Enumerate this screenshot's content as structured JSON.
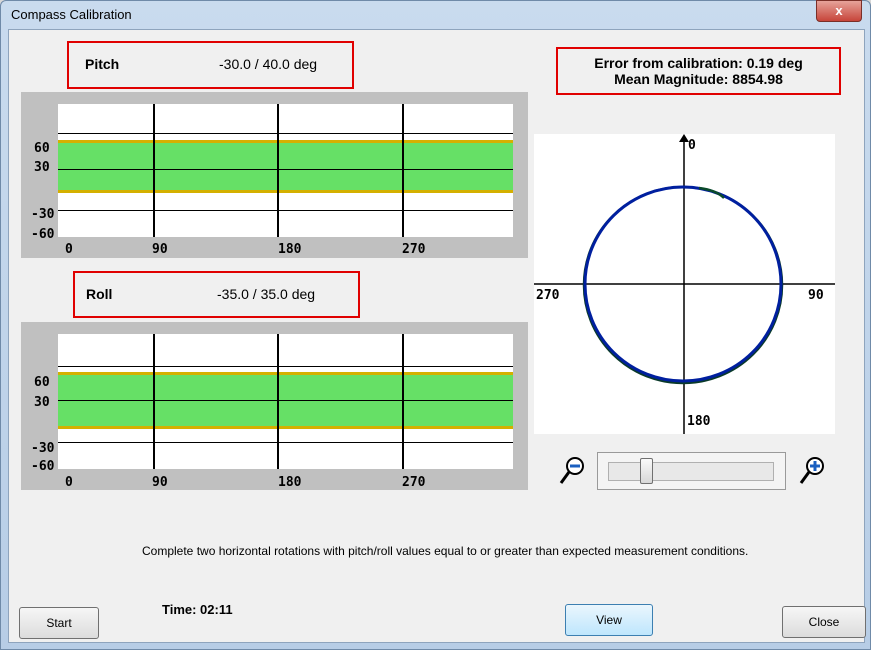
{
  "window": {
    "title": "Compass Calibration",
    "close_glyph": "x"
  },
  "pitch": {
    "label": "Pitch",
    "range": "-30.0 / 40.0 deg"
  },
  "roll": {
    "label": "Roll",
    "range": "-35.0 / 35.0 deg"
  },
  "stats": {
    "error": "Error from calibration: 0.19 deg",
    "magnitude": "Mean Magnitude: 8854.98"
  },
  "chart_y_ticks": [
    "60",
    "30",
    "-30",
    "-60"
  ],
  "chart_x_ticks": [
    "0",
    "90",
    "180",
    "270"
  ],
  "compass": {
    "top": "0",
    "right": "90",
    "bottom": "180",
    "left": "270"
  },
  "zoom": {
    "out_icon": "zoom-out-icon",
    "in_icon": "zoom-in-icon",
    "level": 0.25
  },
  "instruction": "Complete two horizontal rotations with pitch/roll values equal to or greater than expected measurement conditions.",
  "timer": "Time: 02:11",
  "buttons": {
    "start": "Start",
    "view": "View",
    "close": "Close"
  },
  "colors": {
    "band": "#66e066",
    "limit": "#d4b000",
    "highlight": "#e00000",
    "trace": "#001f9f"
  }
}
